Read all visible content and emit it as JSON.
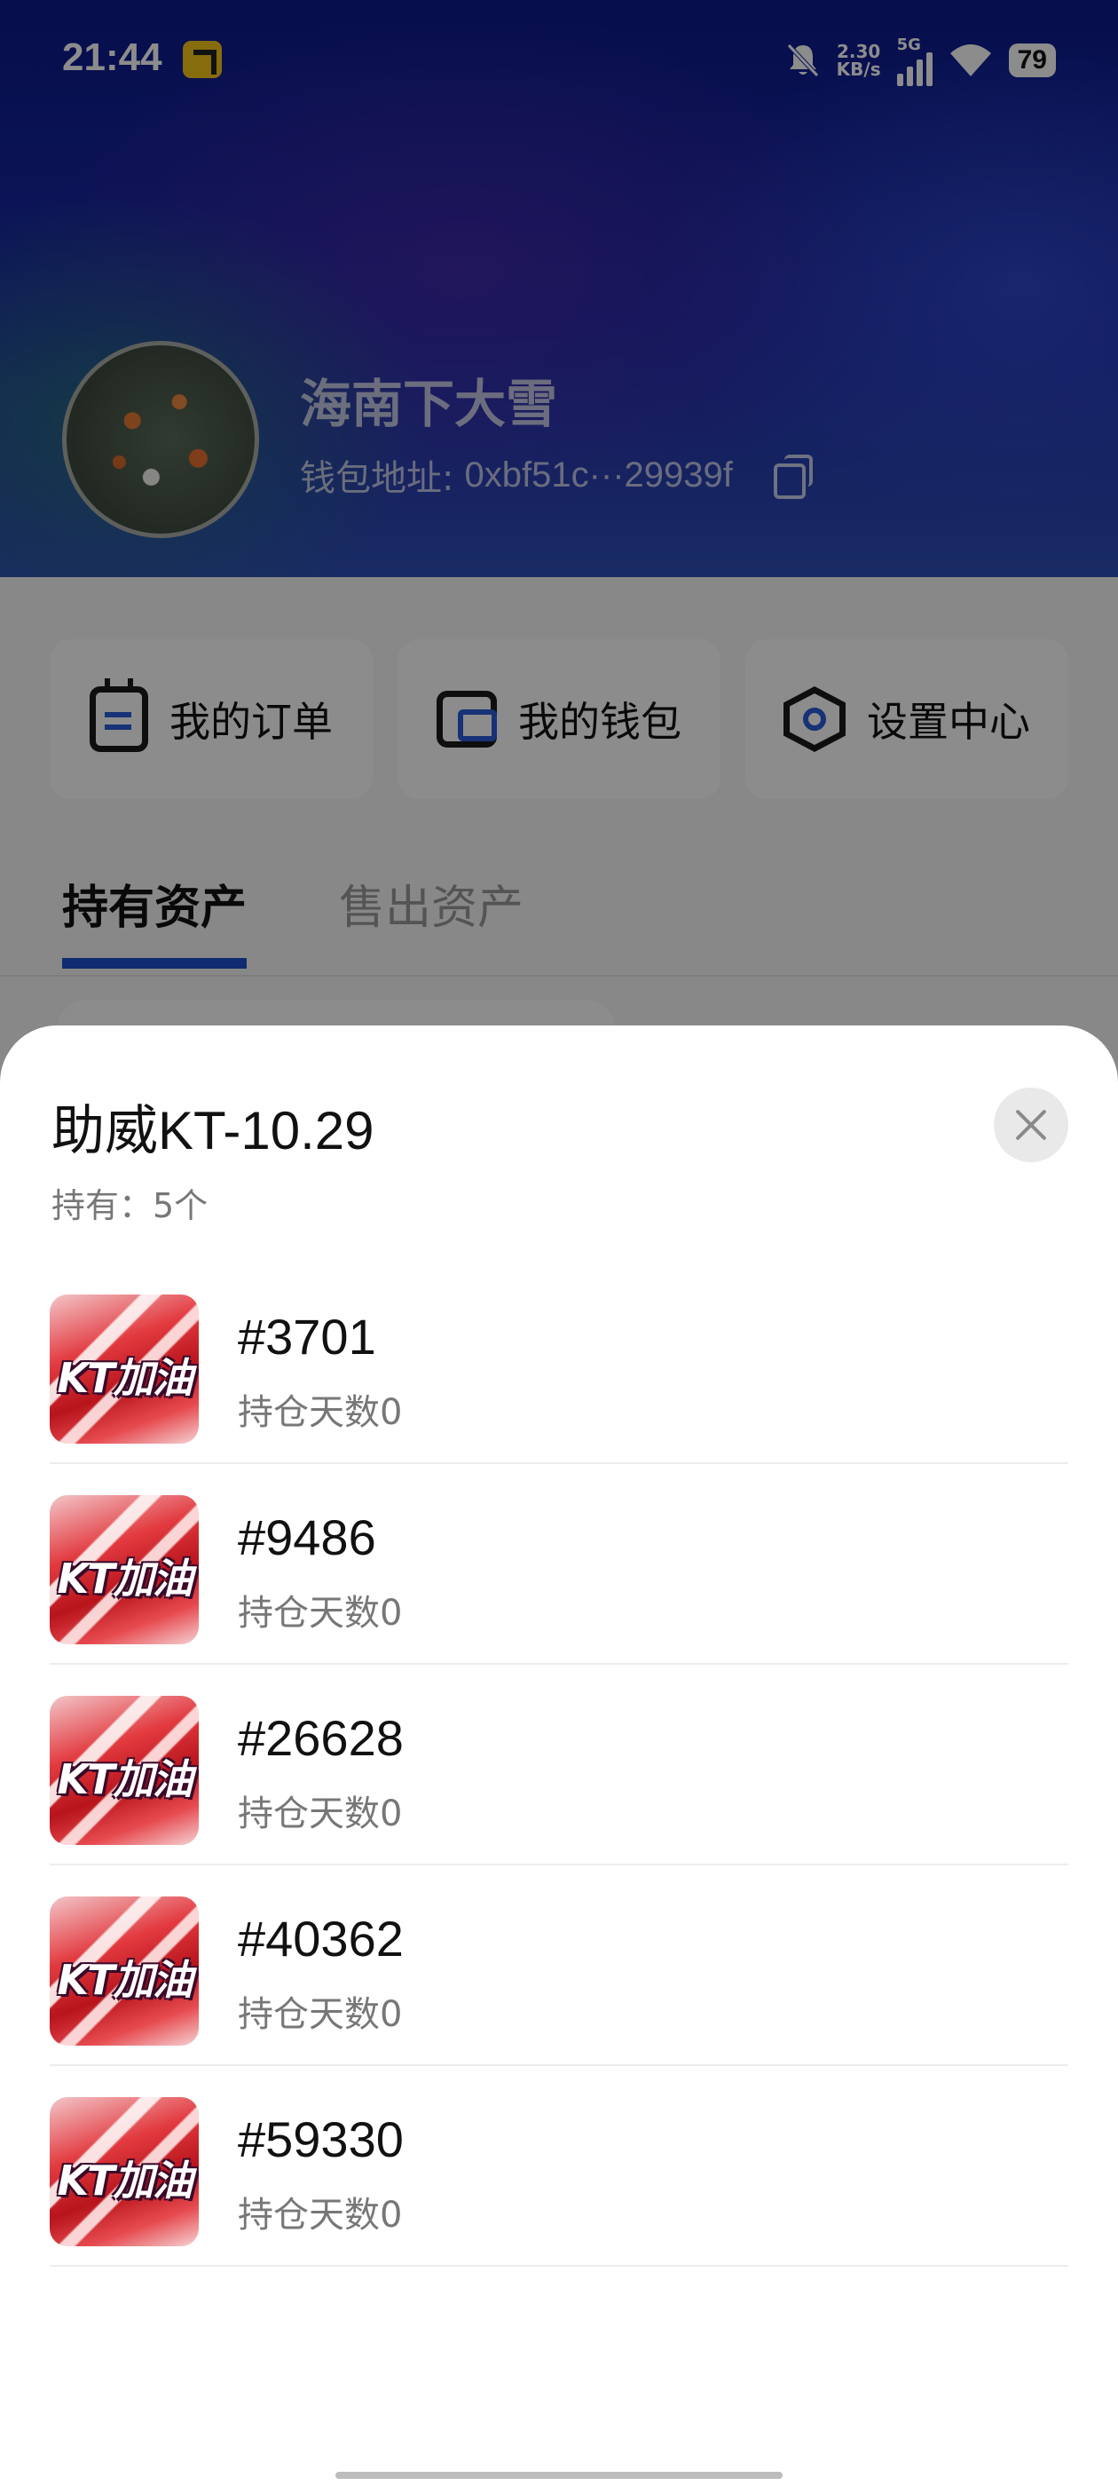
{
  "status_bar": {
    "time": "21:44",
    "net_speed_value": "2.30",
    "net_speed_unit": "KB/s",
    "network": "5G",
    "battery": "79"
  },
  "profile": {
    "nickname": "海南下大雪",
    "wallet_label": "钱包地址:",
    "wallet_address": "0xbf51c···29939f"
  },
  "menu": [
    {
      "label": "我的订单",
      "icon": "order-icon"
    },
    {
      "label": "我的钱包",
      "icon": "wallet-icon"
    },
    {
      "label": "设置中心",
      "icon": "settings-icon"
    }
  ],
  "tabs": [
    {
      "label": "持有资产",
      "active": true
    },
    {
      "label": "售出资产",
      "active": false
    }
  ],
  "sheet": {
    "title": "助威KT-10.29",
    "holding_text": "持有：5个",
    "items": [
      {
        "id": "#3701",
        "sub": "持仓天数0",
        "thumb_text": "KT加油"
      },
      {
        "id": "#9486",
        "sub": "持仓天数0",
        "thumb_text": "KT加油"
      },
      {
        "id": "#26628",
        "sub": "持仓天数0",
        "thumb_text": "KT加油"
      },
      {
        "id": "#40362",
        "sub": "持仓天数0",
        "thumb_text": "KT加油"
      },
      {
        "id": "#59330",
        "sub": "持仓天数0",
        "thumb_text": "KT加油"
      }
    ]
  }
}
